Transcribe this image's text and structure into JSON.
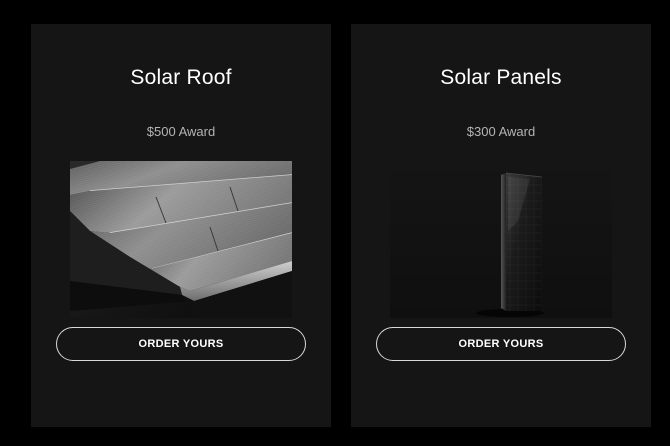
{
  "cards": [
    {
      "title": "Solar Roof",
      "award": "$500 Award",
      "button_label": "ORDER YOURS",
      "image": "solar-roof-tiles"
    },
    {
      "title": "Solar Panels",
      "award": "$300 Award",
      "button_label": "ORDER YOURS",
      "image": "solar-panel"
    }
  ],
  "colors": {
    "page_background": "#000000",
    "card_background": "#151515",
    "title_text": "#ffffff",
    "award_text": "#b4b4b4",
    "button_border": "#d8d8d8"
  }
}
